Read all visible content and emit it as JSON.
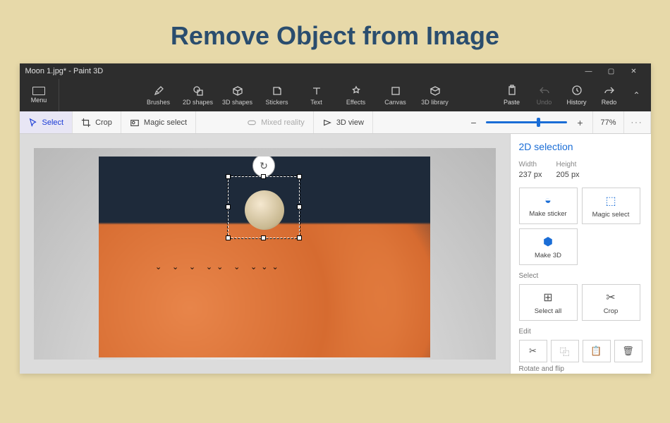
{
  "page": {
    "title": "Remove Object from Image"
  },
  "window": {
    "title": "Moon 1.jpg* - Paint 3D",
    "controls": {
      "min": "—",
      "max": "▢",
      "close": "✕"
    }
  },
  "menu": {
    "label": "Menu"
  },
  "topTools": [
    {
      "label": "Brushes"
    },
    {
      "label": "2D shapes"
    },
    {
      "label": "3D shapes"
    },
    {
      "label": "Stickers"
    },
    {
      "label": "Text"
    },
    {
      "label": "Effects"
    },
    {
      "label": "Canvas"
    },
    {
      "label": "3D library"
    }
  ],
  "rightTop": {
    "paste": "Paste",
    "undo": "Undo",
    "history": "History",
    "redo": "Redo"
  },
  "lightbar": {
    "select": "Select",
    "crop": "Crop",
    "magic": "Magic select",
    "mixed": "Mixed reality",
    "view3d": "3D view",
    "zoom": "77%"
  },
  "panel": {
    "title": "2D selection",
    "widthLabel": "Width",
    "widthVal": "237 px",
    "heightLabel": "Height",
    "heightVal": "205 px",
    "makeSticker": "Make sticker",
    "magicSelect": "Magic select",
    "make3d": "Make 3D",
    "selectLabel": "Select",
    "selectAll": "Select all",
    "crop": "Crop",
    "editLabel": "Edit",
    "rotateLabel": "Rotate and flip"
  }
}
